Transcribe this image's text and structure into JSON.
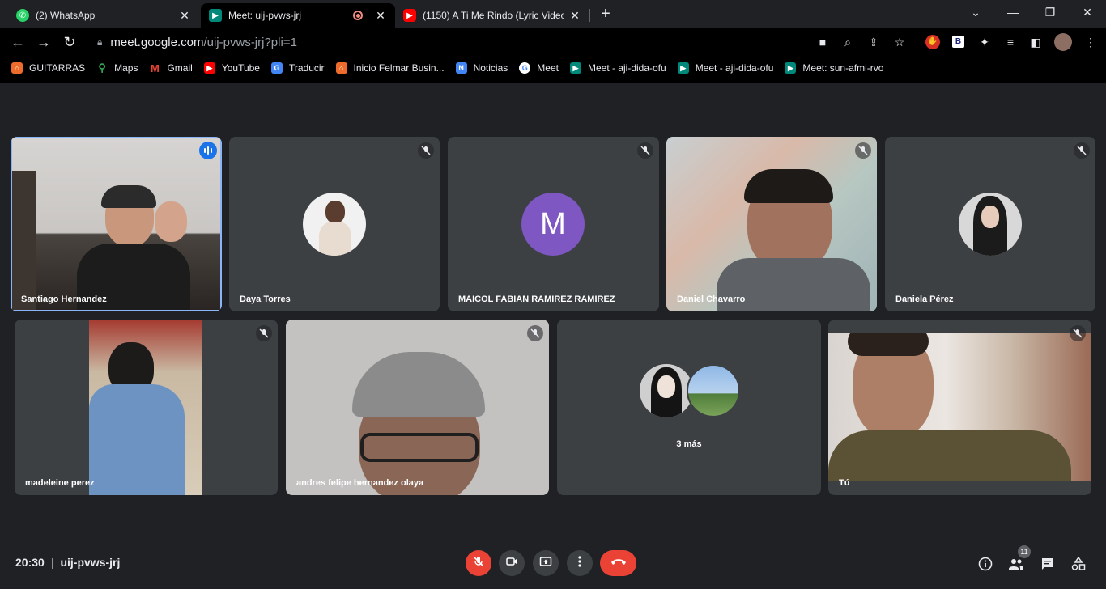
{
  "browser": {
    "tabs": [
      {
        "title": "(2) WhatsApp",
        "icon": "whatsapp-icon",
        "color": "#25d366"
      },
      {
        "title": "Meet: uij-pvws-jrj",
        "icon": "meet-icon",
        "color": "#00897b",
        "active": true
      },
      {
        "title": "(1150) A Ti Me Rindo (Lyric Video",
        "icon": "youtube-icon",
        "color": "#ff0000"
      }
    ],
    "url_host": "meet.google.com",
    "url_path": "/uij-pvws-jrj?pli=1",
    "bookmarks": [
      {
        "label": "GUITARRAS",
        "icon": "folder-icon",
        "color": "#ee6c2b"
      },
      {
        "label": "Maps",
        "icon": "maps-icon",
        "color": "#34a853"
      },
      {
        "label": "Gmail",
        "icon": "gmail-icon",
        "color": "#ea4335"
      },
      {
        "label": "YouTube",
        "icon": "youtube-icon",
        "color": "#ff0000"
      },
      {
        "label": "Traducir",
        "icon": "translate-icon",
        "color": "#4285f4"
      },
      {
        "label": "Inicio Felmar Busin...",
        "icon": "folder-icon",
        "color": "#ee6c2b"
      },
      {
        "label": "Noticias",
        "icon": "news-icon",
        "color": "#4285f4"
      },
      {
        "label": "Meet",
        "icon": "google-icon",
        "color": "#4285f4"
      },
      {
        "label": "Meet - aji-dida-ofu",
        "icon": "meet-icon",
        "color": "#00897b"
      },
      {
        "label": "Meet - aji-dida-ofu",
        "icon": "meet-icon",
        "color": "#00897b"
      },
      {
        "label": "Meet: sun-afmi-rvo",
        "icon": "meet-icon",
        "color": "#00897b"
      }
    ]
  },
  "participants": [
    {
      "name": "Santiago Hernandez",
      "speaking": true
    },
    {
      "name": "Daya Torres"
    },
    {
      "name": "MAICOL FABIAN RAMIREZ RAMIREZ",
      "initial": "M",
      "avatar_color": "#7e57c2"
    },
    {
      "name": "Daniel Chavarro"
    },
    {
      "name": "Daniela Pérez"
    },
    {
      "name": "madeleine perez"
    },
    {
      "name": "andres felipe hernandez olaya"
    },
    {
      "name": "3 más"
    },
    {
      "name": "Tú"
    }
  ],
  "meeting": {
    "time": "20:30",
    "separator": "|",
    "code": "uij-pvws-jrj",
    "participant_count": "11"
  },
  "colors": {
    "background": "#202124",
    "tile": "#3c4043",
    "accent": "#8ab4f8",
    "danger": "#ea4335"
  }
}
